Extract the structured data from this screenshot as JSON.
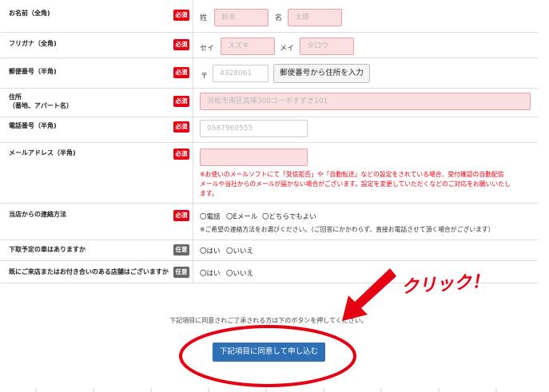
{
  "badges": {
    "required": "必須",
    "optional": "任意"
  },
  "name": {
    "label": "お名前（全角)",
    "sei_label": "姓",
    "sei_placeholder": "鈴木",
    "mei_label": "名",
    "mei_placeholder": "太郎"
  },
  "furigana": {
    "label": "フリガナ（全角)",
    "sei_label": "セイ",
    "sei_placeholder": "スズキ",
    "mei_label": "メイ",
    "mei_placeholder": "タロウ"
  },
  "postal": {
    "label": "郵便番号（半角)",
    "mark": "〒",
    "placeholder": "4328061",
    "button_label": "郵便番号から住所を入力"
  },
  "address": {
    "label": "住所",
    "sublabel": "（番地、アパート名）",
    "placeholder": "浜松市南区高塚300コーポすずき101"
  },
  "phone": {
    "label": "電話番号（半角)",
    "placeholder": "0587960555"
  },
  "email": {
    "label": "メールアドレス（半角)",
    "placeholder": "",
    "note_lines": [
      "※お使いのメールソフトにて「受信拒否」や「自動転送」などの設定をされている場合、受付確認の自動配信",
      "メールや当社からのメールが届かない場合がございます。設定を変更していただくなどのご対応をお願いいたし",
      "ます。"
    ]
  },
  "contact_method": {
    "label": "当店からの連絡方法",
    "options": [
      "〇電話",
      "〇Eメール",
      "〇どちらでもよい"
    ],
    "note": "※ご希望の連絡方法をお選びください。（ご回答にかかわらず、直接お電話させて頂く場合がございます）"
  },
  "trade_in": {
    "label": "下取予定の車はありますか",
    "options": [
      "〇はい",
      "〇いいえ"
    ]
  },
  "visited": {
    "label": "既にご来店またはお付き合いのある店舗はございますか",
    "options": [
      "〇はい",
      "〇いいえ"
    ]
  },
  "agreement_text": "下記項目に同意されご了承される方は下のボタンを押してください。",
  "submit_label": "下記項目に同意して申し込む",
  "annotation": {
    "text": "クリック！",
    "color": "#e50012"
  }
}
